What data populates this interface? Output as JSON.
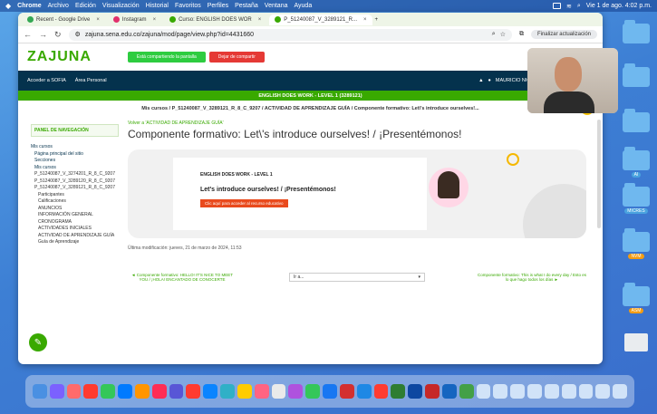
{
  "menubar": {
    "apple": "",
    "app": "Chrome",
    "items": [
      "Archivo",
      "Edición",
      "Visualización",
      "Historial",
      "Favoritos",
      "Perfiles",
      "Pestaña",
      "Ventana",
      "Ayuda"
    ],
    "clock": "Vie 1 de ago. 4:02 p.m."
  },
  "tabs": [
    {
      "label": "Recent - Google Drive",
      "color": "#34a853"
    },
    {
      "label": "Instagram",
      "color": "#e1306c"
    },
    {
      "label": "Curso: ENGLISH DOES WOR",
      "color": "#39a900"
    },
    {
      "label": "P_51240087_V_3289121_R...",
      "color": "#39a900"
    }
  ],
  "address": {
    "url": "zajuna.sena.edu.co/zajuna/mod/page/view.php?id=4431660",
    "update_label": "Finalizar actualización"
  },
  "site": {
    "logo": "ZAJUNA",
    "share_notice": "Está compartiendo la pantalla",
    "stop_share": "Dejar de compartir",
    "nav": [
      "Acceder a SOFIA",
      "Área Personal"
    ],
    "user": "MAURICIO NICOLAS VELEZ SIERRA"
  },
  "course_bar": "ENGLISH DOES WORK - LEVEL 1 (3289121)",
  "breadcrumb": "Mis cursos / P_51240087_V_3289121_R_8_C_9207 / ACTIVIDAD DE APRENDIZAJE GUÍA / Componente formativo: Let\\'s introduce ourselves!...",
  "sidebar": {
    "title": "PANEL DE NAVEGACIÓN",
    "items": [
      {
        "label": "Mis cursos",
        "level": 0
      },
      {
        "label": "Página principal del sitio",
        "level": 1
      },
      {
        "label": "Secciones",
        "level": 1
      },
      {
        "label": "Mis cursos",
        "level": 1
      },
      {
        "label": "P_51240087_V_3274201_R_8_C_9207",
        "level": 1
      },
      {
        "label": "P_51240087_V_3289120_R_8_C_9207",
        "level": 1
      },
      {
        "label": "P_51240087_V_3289121_R_8_C_9207",
        "level": 1
      },
      {
        "label": "Participantes",
        "level": 2
      },
      {
        "label": "Calificaciones",
        "level": 2
      },
      {
        "label": "ANUNCIOS",
        "level": 2
      },
      {
        "label": "INFORMACIÓN GENERAL",
        "level": 2
      },
      {
        "label": "CRONOGRAMA",
        "level": 2
      },
      {
        "label": "ACTIVIDADES INICIALES",
        "level": 2
      },
      {
        "label": "ACTIVIDAD DE APRENDIZAJE GUÍA",
        "level": 2
      },
      {
        "label": "Guía de Aprendizaje",
        "level": 2
      }
    ]
  },
  "main": {
    "back": "Volver a 'ACTIVIDAD DE APRENDIZAJE GUÍA'",
    "title": "Componente formativo: Let\\'s introduce ourselves! / ¡Presentémonos!",
    "banner": {
      "kicker": "ENGLISH DOES WORK - LEVEL 1",
      "heading": "Let's introduce ourselves! / ¡Presentémonos!",
      "cta": "Clic aquí para acceder al recurso educativo"
    },
    "last_modified": "Última modificación: jueves, 21 de marzo de 2024, 11:53",
    "prev": "◄ Componente formativo: HELLO! IT'S NICE TO MEET YOU / ¡HOLA! ENCANTADO DE CONOCERTE",
    "jump": "Ir a...",
    "next": "Componente formativo: This is what I do every day / Esto es lo que hago todos los días ►"
  },
  "desktop": {
    "labels": [
      "AI",
      "MICRES",
      "NVM",
      "ASM"
    ]
  }
}
